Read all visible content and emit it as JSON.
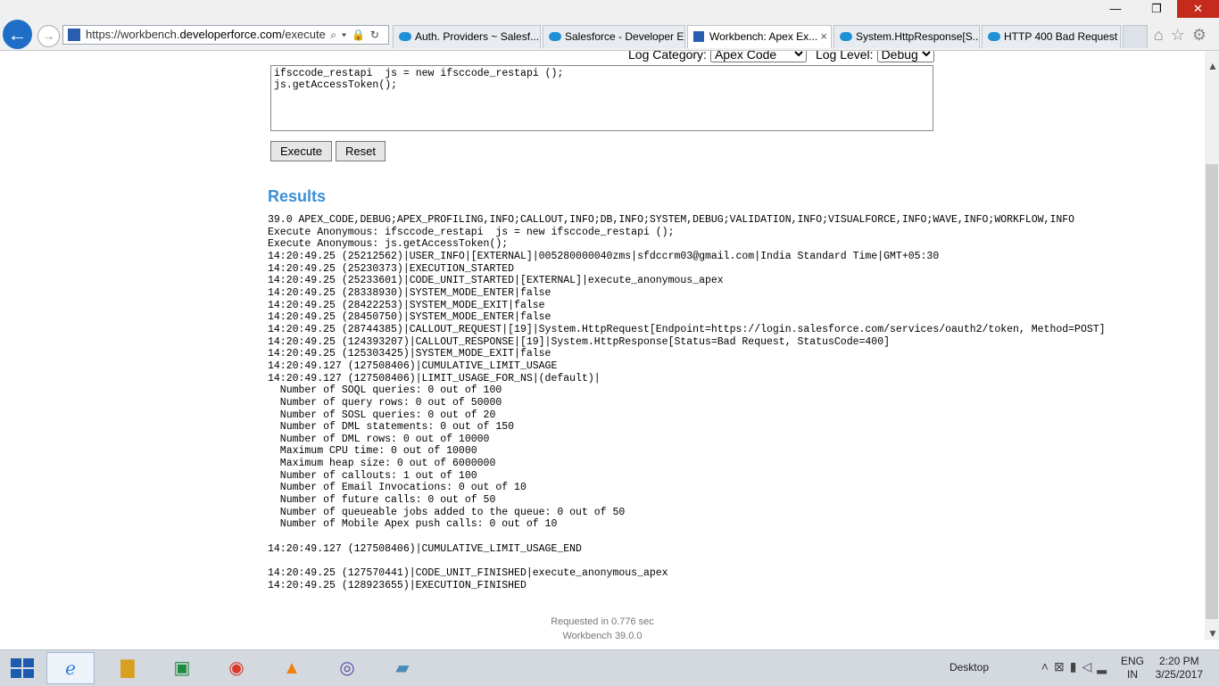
{
  "browser": {
    "url_prefix": "https://workbench.",
    "url_domain": "developerforce.com",
    "url_suffix": "/execute.ph",
    "tabs": [
      {
        "label": "Auth. Providers ~ Salesf...",
        "icon": "cloud-icon"
      },
      {
        "label": "Salesforce - Developer E...",
        "icon": "cloud-icon"
      },
      {
        "label": "Workbench: Apex Ex...",
        "icon": "workbench-icon",
        "active": true,
        "close": "×"
      },
      {
        "label": "System.HttpResponse[S...",
        "icon": "cloud-icon"
      },
      {
        "label": "HTTP 400 Bad Request",
        "icon": "cloud-icon"
      }
    ]
  },
  "options": {
    "log_category_label": "Log Category:",
    "log_category_value": "Apex Code",
    "log_level_label": "Log Level:",
    "log_level_value": "Debug"
  },
  "editor": {
    "code": "ifsccode_restapi  js = new ifsccode_restapi ();\njs.getAccessToken();"
  },
  "buttons": {
    "execute": "Execute",
    "reset": "Reset"
  },
  "results": {
    "title": "Results",
    "log": "39.0 APEX_CODE,DEBUG;APEX_PROFILING,INFO;CALLOUT,INFO;DB,INFO;SYSTEM,DEBUG;VALIDATION,INFO;VISUALFORCE,INFO;WAVE,INFO;WORKFLOW,INFO\nExecute Anonymous: ifsccode_restapi  js = new ifsccode_restapi ();\nExecute Anonymous: js.getAccessToken();\n14:20:49.25 (25212562)|USER_INFO|[EXTERNAL]|005280000040zms|sfdccrm03@gmail.com|India Standard Time|GMT+05:30\n14:20:49.25 (25230373)|EXECUTION_STARTED\n14:20:49.25 (25233601)|CODE_UNIT_STARTED|[EXTERNAL]|execute_anonymous_apex\n14:20:49.25 (28338930)|SYSTEM_MODE_ENTER|false\n14:20:49.25 (28422253)|SYSTEM_MODE_EXIT|false\n14:20:49.25 (28450750)|SYSTEM_MODE_ENTER|false\n14:20:49.25 (28744385)|CALLOUT_REQUEST|[19]|System.HttpRequest[Endpoint=https://login.salesforce.com/services/oauth2/token, Method=POST]\n14:20:49.25 (124393207)|CALLOUT_RESPONSE|[19]|System.HttpResponse[Status=Bad Request, StatusCode=400]\n14:20:49.25 (125303425)|SYSTEM_MODE_EXIT|false\n14:20:49.127 (127508406)|CUMULATIVE_LIMIT_USAGE\n14:20:49.127 (127508406)|LIMIT_USAGE_FOR_NS|(default)|\n  Number of SOQL queries: 0 out of 100\n  Number of query rows: 0 out of 50000\n  Number of SOSL queries: 0 out of 20\n  Number of DML statements: 0 out of 150\n  Number of DML rows: 0 out of 10000\n  Maximum CPU time: 0 out of 10000\n  Maximum heap size: 0 out of 6000000\n  Number of callouts: 1 out of 100\n  Number of Email Invocations: 0 out of 10\n  Number of future calls: 0 out of 50\n  Number of queueable jobs added to the queue: 0 out of 50\n  Number of Mobile Apex push calls: 0 out of 10\n\n14:20:49.127 (127508406)|CUMULATIVE_LIMIT_USAGE_END\n\n14:20:49.25 (127570441)|CODE_UNIT_FINISHED|execute_anonymous_apex\n14:20:49.25 (128923655)|EXECUTION_FINISHED"
  },
  "footer": {
    "requested": "Requested in 0.776 sec",
    "version": "Workbench 39.0.0"
  },
  "taskbar": {
    "desktop_label": "Desktop",
    "lang_line1": "ENG",
    "lang_line2": "IN",
    "time": "2:20 PM",
    "date": "3/25/2017"
  }
}
